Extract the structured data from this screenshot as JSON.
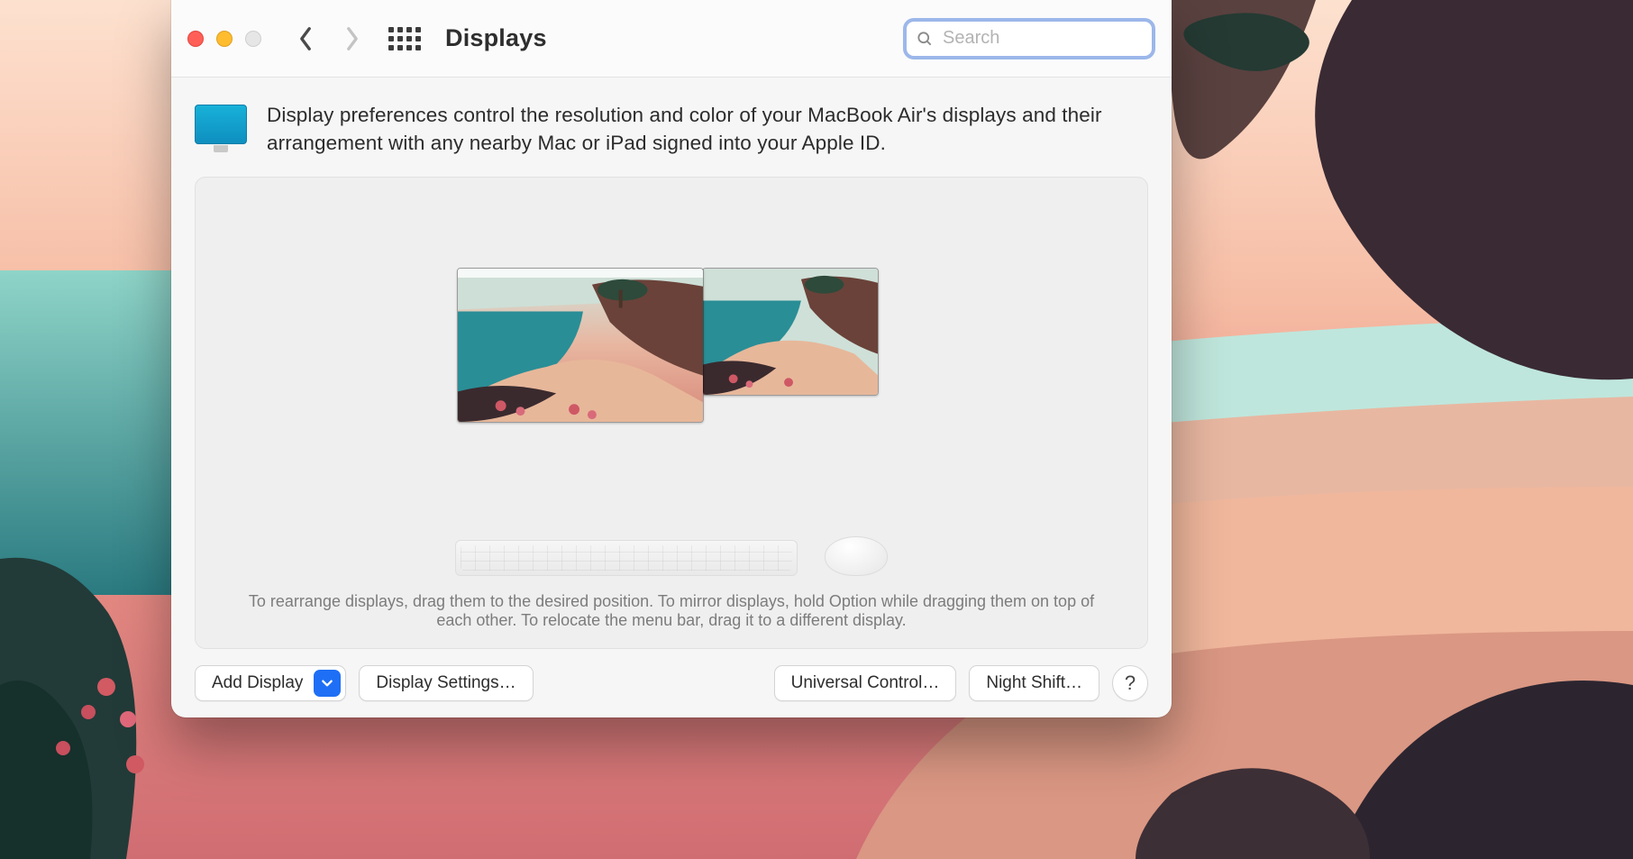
{
  "toolbar": {
    "title": "Displays",
    "search_placeholder": "Search",
    "search_value": ""
  },
  "header": {
    "description": "Display preferences control the resolution and color of your MacBook Air's displays and their arrangement with any nearby Mac or iPad signed into your Apple ID."
  },
  "panel": {
    "help_text": "To rearrange displays, drag them to the desired position. To mirror displays, hold Option while dragging them on top of each other. To relocate the menu bar, drag it to a different display."
  },
  "buttons": {
    "add_display": "Add Display",
    "display_settings": "Display Settings…",
    "universal_control": "Universal Control…",
    "night_shift": "Night Shift…",
    "help": "?"
  }
}
